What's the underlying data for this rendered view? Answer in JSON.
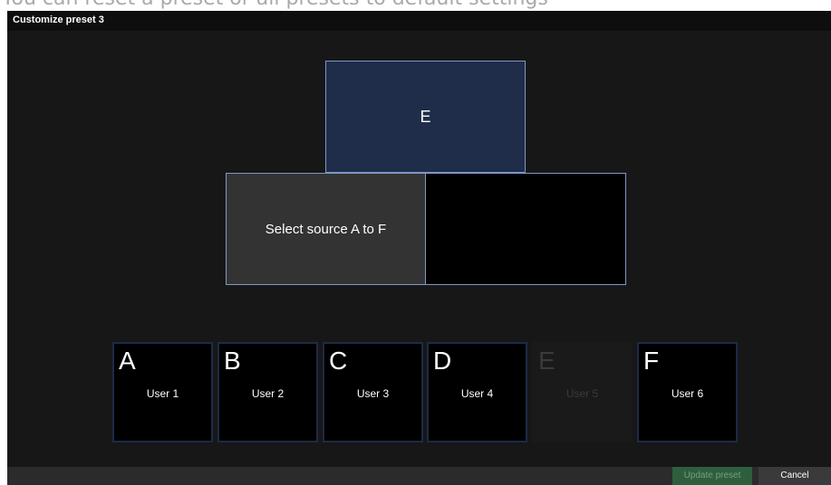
{
  "caption": "You can reset a preset or all presets to default settings",
  "dialog": {
    "title": "Customize preset 3"
  },
  "layout_slots": {
    "top_label": "E",
    "left_label": "Select source A to F",
    "right_label": ""
  },
  "sources": [
    {
      "letter": "A",
      "user": "User 1",
      "enabled": true
    },
    {
      "letter": "B",
      "user": "User 2",
      "enabled": true
    },
    {
      "letter": "C",
      "user": "User 3",
      "enabled": true
    },
    {
      "letter": "D",
      "user": "User 4",
      "enabled": true
    },
    {
      "letter": "E",
      "user": "User 5",
      "enabled": false
    },
    {
      "letter": "F",
      "user": "User 6",
      "enabled": true
    }
  ],
  "buttons": {
    "update": "Update preset",
    "cancel": "Cancel"
  },
  "colors": {
    "selected_slot": "#1f2d4a",
    "slot_border": "#7f97c6",
    "update_button": "#2e5f3d"
  }
}
